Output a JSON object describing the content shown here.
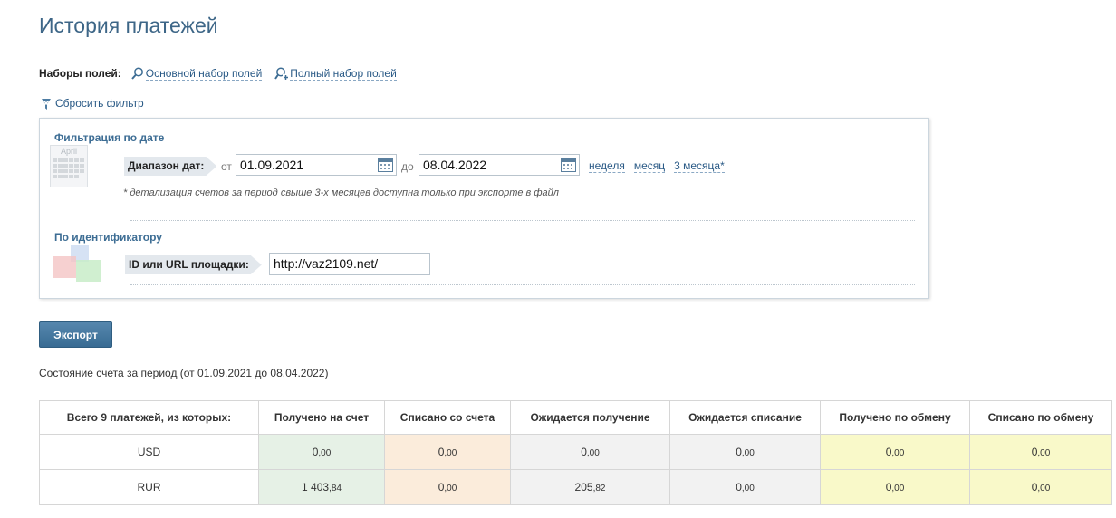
{
  "page": {
    "title": "История платежей"
  },
  "field_sets": {
    "label": "Наборы полей:",
    "basic": "Основной набор полей",
    "full": "Полный набор полей"
  },
  "reset_filter": "Сбросить фильтр",
  "date_filter": {
    "title": "Фильтрация по дате",
    "calendar_month": "April",
    "range_label": "Диапазон дат:",
    "from_label": "от",
    "from_value": "01.09.2021",
    "to_label": "до",
    "to_value": "08.04.2022",
    "periods": [
      "неделя",
      "месяц",
      "3 месяца*"
    ],
    "note": "* детализация счетов за период свыше 3-х месяцев доступна только при экспорте в файл"
  },
  "id_filter": {
    "title": "По идентификатору",
    "label": "ID или URL площадки:",
    "value": "http://vaz2109.net/"
  },
  "export_label": "Экспорт",
  "status_text": "Состояние счета за период (от 01.09.2021 до 08.04.2022)",
  "table": {
    "headers": [
      "Всего 9 платежей, из которых:",
      "Получено на счет",
      "Списано со счета",
      "Ожидается получение",
      "Ожидается списание",
      "Получено по обмену",
      "Списано по обмену"
    ],
    "rows": [
      {
        "currency": "USD",
        "values": [
          [
            "0",
            ",00"
          ],
          [
            "0",
            ",00"
          ],
          [
            "0",
            ",00"
          ],
          [
            "0",
            ",00"
          ],
          [
            "0",
            ",00"
          ],
          [
            "0",
            ",00"
          ]
        ]
      },
      {
        "currency": "RUR",
        "values": [
          [
            "1 403",
            ",84"
          ],
          [
            "0",
            ",00"
          ],
          [
            "205",
            ",82"
          ],
          [
            "0",
            ",00"
          ],
          [
            "0",
            ",00"
          ],
          [
            "0",
            ",00"
          ]
        ]
      }
    ]
  },
  "colors": {
    "received": "#e6f1e6",
    "debited": "#fbecdb",
    "expected": "#f2f2f2",
    "exchange": "#f9f9c9",
    "accent": "#3d6687"
  }
}
